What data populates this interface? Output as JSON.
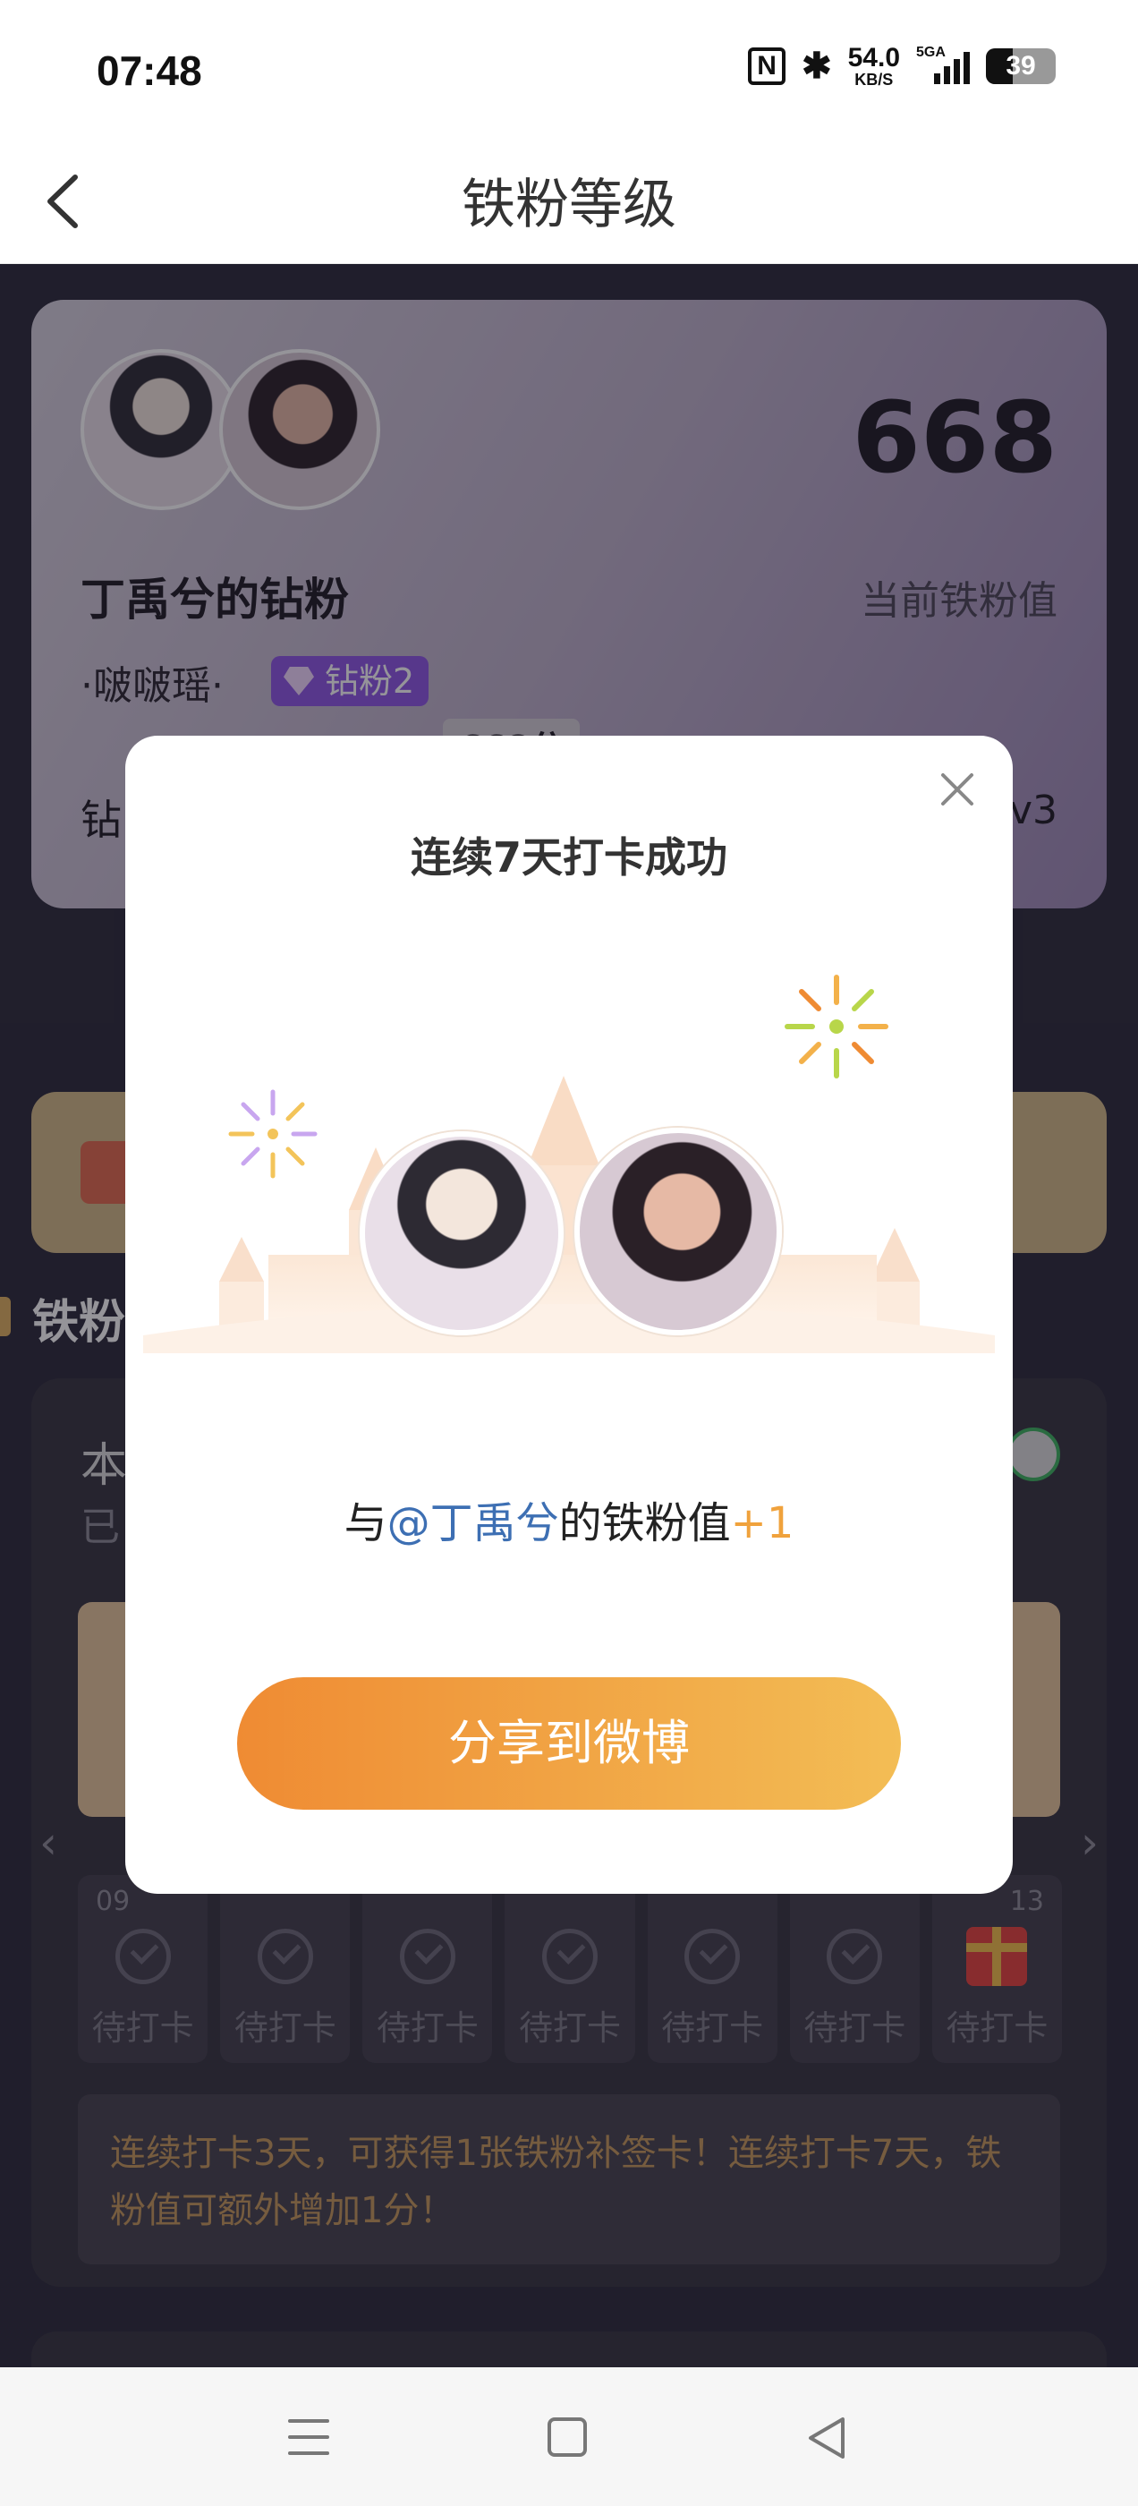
{
  "status_bar": {
    "time": "07:48",
    "nfc": "N",
    "net_speed": "54.0",
    "net_unit": "KB/S",
    "network": "5GA",
    "battery": "39"
  },
  "header": {
    "title": "铁粉等级"
  },
  "profile_card": {
    "name": "丁禹兮的钻粉",
    "nickname": "·啵啵瑶·",
    "badge": "钻粉2",
    "score": "668",
    "score_label": "当前铁粉值",
    "progress_tag": "668分",
    "left_fragment": "钻",
    "right_fragment": "v3"
  },
  "section": {
    "title": "铁粉"
  },
  "checkin": {
    "fragment_1": "本",
    "fragment_2": "已",
    "first_date": "09",
    "last_date": "13",
    "days": [
      {
        "label": "待打卡",
        "icon": "check-circle-icon"
      },
      {
        "label": "待打卡",
        "icon": "check-circle-icon"
      },
      {
        "label": "待打卡",
        "icon": "check-circle-icon"
      },
      {
        "label": "待打卡",
        "icon": "check-circle-icon"
      },
      {
        "label": "待打卡",
        "icon": "check-circle-icon"
      },
      {
        "label": "待打卡",
        "icon": "check-circle-icon"
      },
      {
        "label": "待打卡",
        "icon": "gift-icon"
      }
    ],
    "hint": "连续打卡3天，可获得1张铁粉补签卡！连续打卡7天，铁粉值可额外增加1分！",
    "prev_arrow": "‹",
    "next_arrow": "›"
  },
  "modal": {
    "title": "连续7天打卡成功",
    "message_prefix": "与",
    "mention": "@丁禹兮",
    "message_middle": "的铁粉值",
    "message_plus": "+1",
    "share_button": "分享到微博"
  },
  "colors": {
    "accent_orange": "#ef8b33",
    "accent_yellow": "#f3bd55",
    "mention_blue": "#3d6fb3",
    "hint_gold": "#c79a5c",
    "badge_purple": "#8f57e6"
  }
}
